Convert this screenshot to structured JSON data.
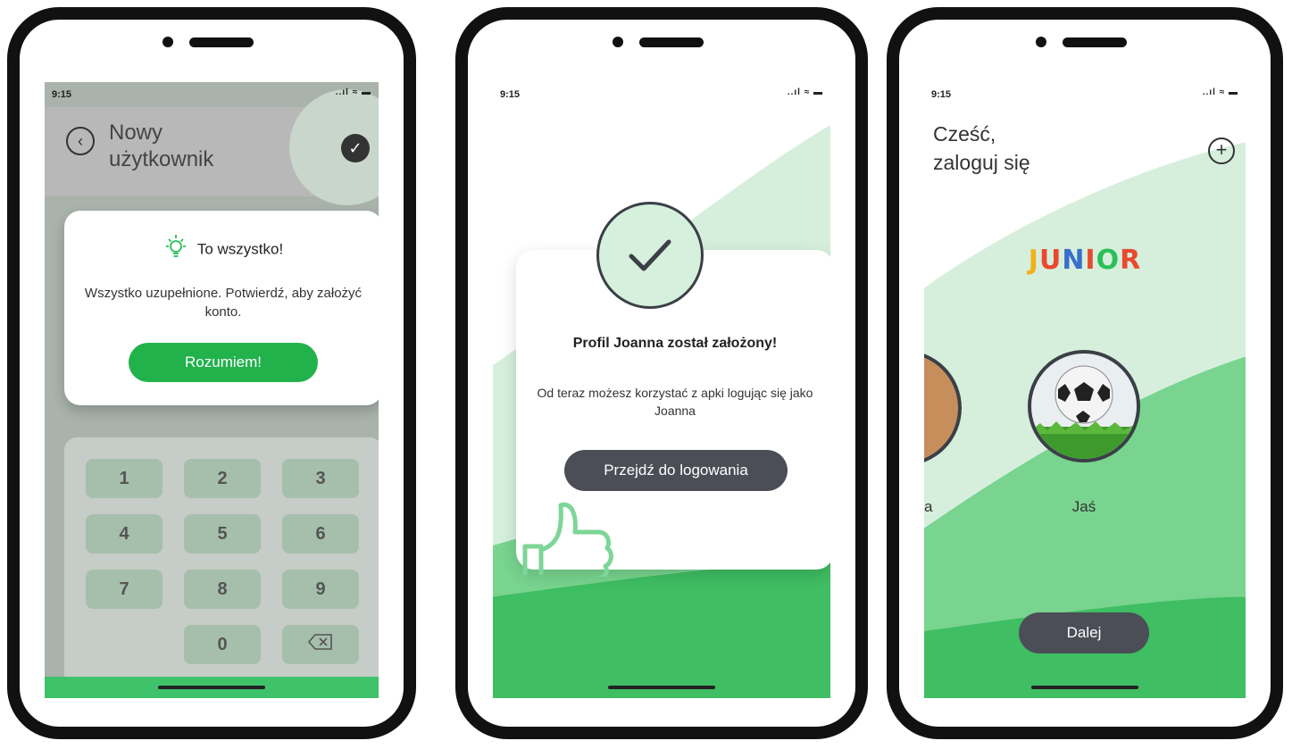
{
  "phone1": {
    "status_time": "9:15",
    "status_icons": "..ıl ≈ ▬",
    "title": "Nowy\nużytkownik",
    "modal_title": "To wszystko!",
    "modal_text": "Wszystko uzupełnione. Potwierdź, aby założyć konto.",
    "button_label": "Rozumiem!",
    "keys": [
      "1",
      "2",
      "3",
      "4",
      "5",
      "6",
      "7",
      "8",
      "9",
      "0"
    ]
  },
  "phone2": {
    "status_time": "9:15",
    "status_icons": "..ıl ≈ ▬",
    "title": "Profil Joanna został założony!",
    "text": "Od teraz możesz korzystać z apki logując się jako Joanna",
    "button_label": "Przejdź do logowania"
  },
  "phone3": {
    "status_time": "9:15",
    "status_icons": "..ıl ≈ ▬",
    "greeting": "Cześć,\nzaloguj się",
    "logo_letters": [
      "J",
      "U",
      "N",
      "I",
      "O",
      "R"
    ],
    "logo_colors": [
      "#f2b01e",
      "#e8492f",
      "#3a6fc9",
      "#e8492f",
      "#2bbf5a",
      "#e8492f"
    ],
    "profile_partial_name": "a",
    "profile_name": "Jaś",
    "button_label": "Dalej"
  },
  "colors": {
    "green": "#22b24c",
    "dark": "#4b4e57",
    "light_green": "#d5f0dc"
  }
}
